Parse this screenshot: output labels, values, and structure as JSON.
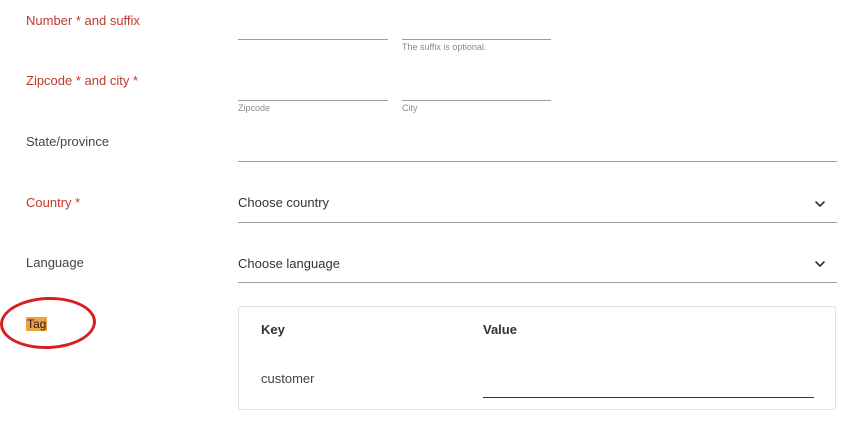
{
  "fields": {
    "number_suffix": {
      "label": "Number * and suffix",
      "suffix_hint": "The suffix is optional."
    },
    "zipcode_city": {
      "label": "Zipcode * and city *",
      "zipcode_hint": "Zipcode",
      "city_hint": "City"
    },
    "state": {
      "label": "State/province"
    },
    "country": {
      "label": "Country *",
      "value": "Choose country"
    },
    "language": {
      "label": "Language",
      "value": "Choose language"
    },
    "tag": {
      "label": "Tag",
      "key_header": "Key",
      "value_header": "Value",
      "rows": [
        {
          "key": "customer",
          "value": ""
        }
      ]
    }
  },
  "colors": {
    "required": "#c0392b",
    "highlight": "#f0a046",
    "annotation": "#d81e1e"
  },
  "icons": {
    "select_chevron": "chevron-down-icon"
  }
}
